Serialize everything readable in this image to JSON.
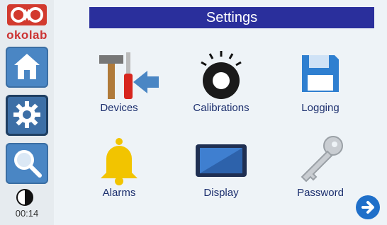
{
  "app": {
    "brand": "okolab",
    "title": "Settings",
    "time": "00:14"
  },
  "sidebar": {
    "items": [
      {
        "name": "home",
        "icon": "home-icon"
      },
      {
        "name": "settings",
        "icon": "gear-icon",
        "active": true
      },
      {
        "name": "search",
        "icon": "magnifier-icon"
      }
    ]
  },
  "grid": {
    "items": [
      {
        "label": "Devices",
        "icon": "tools-icon"
      },
      {
        "label": "Calibrations",
        "icon": "knob-icon"
      },
      {
        "label": "Logging",
        "icon": "floppy-icon"
      },
      {
        "label": "Alarms",
        "icon": "bell-icon"
      },
      {
        "label": "Display",
        "icon": "tablet-icon"
      },
      {
        "label": "Password",
        "icon": "key-icon"
      }
    ]
  },
  "colors": {
    "header": "#2a2f9c",
    "accent": "#4a86c4",
    "label": "#1c2f6e"
  }
}
